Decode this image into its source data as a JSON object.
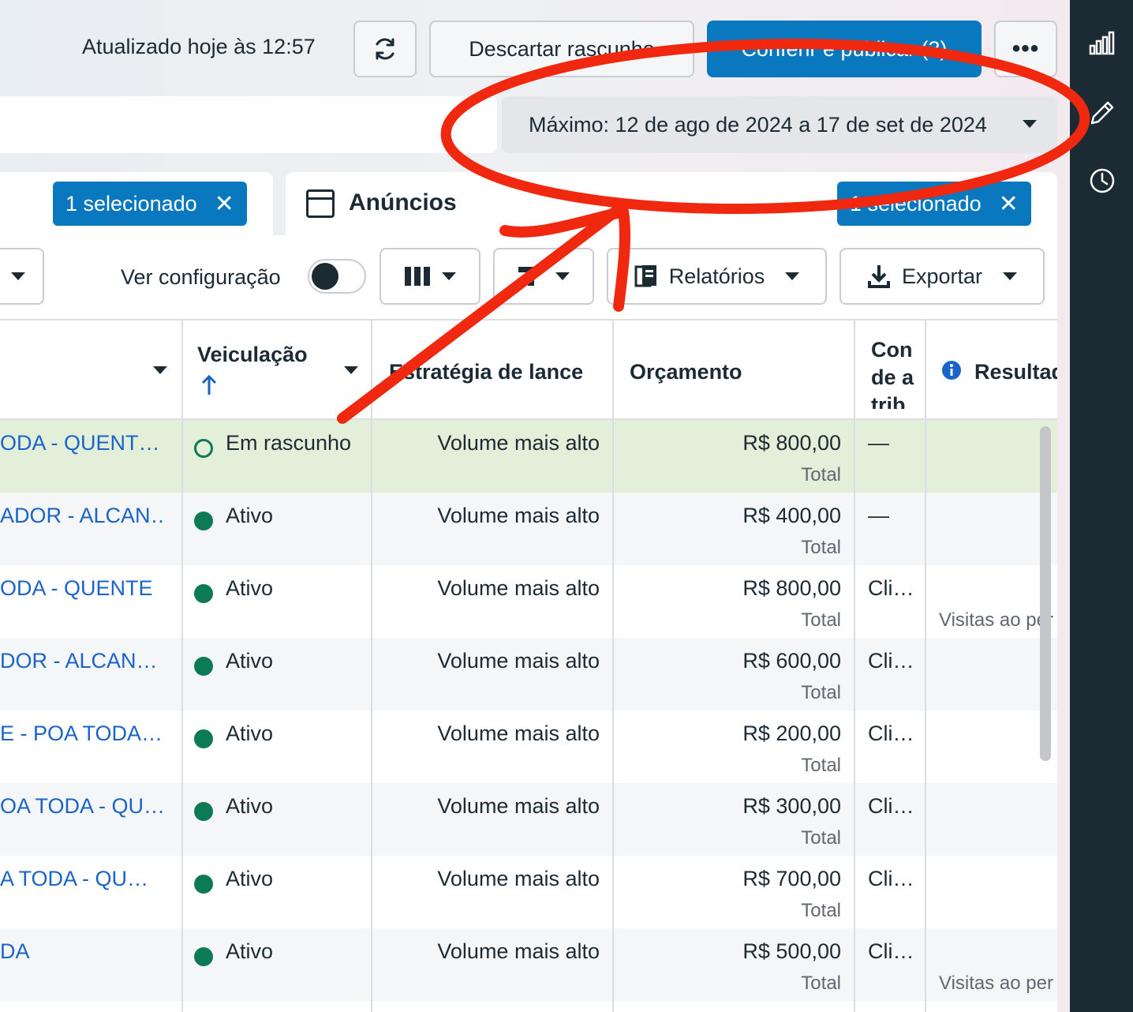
{
  "header": {
    "updated_text": "Atualizado hoje às 12:57",
    "discard_label": "Descartar rascunho",
    "publish_label": "Conferir e publicar (3)",
    "more_label": "•••"
  },
  "date_range": {
    "label": "Máximo: 12 de ago de 2024 a 17 de set de 2024"
  },
  "tabs": {
    "left_chip": "1 selecionado",
    "right_title": "Anúncios",
    "right_chip": "1 selecionado",
    "chip_close": "✕"
  },
  "toolbar": {
    "ver_config_label": "Ver configuração",
    "reports_label": "Relatórios",
    "export_label": "Exportar"
  },
  "table": {
    "headers": {
      "veiculacao": "Veiculação",
      "estrategia": "Estratégia de lance",
      "orcamento": "Orçamento",
      "config": "Configuração de atribuição",
      "config_visible": "Con de atrib",
      "resultados": "Resultados"
    },
    "rows": [
      {
        "name": "ODA - QUENT…",
        "status": "Em rascunho",
        "bid": "Volume mais alto",
        "budget": "R$ 800,00",
        "budget_sub": "Total",
        "attr": "—",
        "result": ""
      },
      {
        "name": "ADOR - ALCAN…",
        "status": "Ativo",
        "bid": "Volume mais alto",
        "budget": "R$ 400,00",
        "budget_sub": "Total",
        "attr": "—",
        "result": ""
      },
      {
        "name": "ODA - QUENTE",
        "status": "Ativo",
        "bid": "Volume mais alto",
        "budget": "R$ 800,00",
        "budget_sub": "Total",
        "attr": "Cli…",
        "result": "Visitas ao per"
      },
      {
        "name": "DOR - ALCAN…",
        "status": "Ativo",
        "bid": "Volume mais alto",
        "budget": "R$ 600,00",
        "budget_sub": "Total",
        "attr": "Cli…",
        "result": ""
      },
      {
        "name": "E - POA TODA…",
        "status": "Ativo",
        "bid": "Volume mais alto",
        "budget": "R$ 200,00",
        "budget_sub": "Total",
        "attr": "Cli…",
        "result": ""
      },
      {
        "name": "OA TODA - QU…",
        "status": "Ativo",
        "bid": "Volume mais alto",
        "budget": "R$ 300,00",
        "budget_sub": "Total",
        "attr": "Cli…",
        "result": ""
      },
      {
        "name": "A TODA - QU…",
        "status": "Ativo",
        "bid": "Volume mais alto",
        "budget": "R$ 700,00",
        "budget_sub": "Total",
        "attr": "Cli…",
        "result": ""
      },
      {
        "name": "DA",
        "status": "Ativo",
        "bid": "Volume mais alto",
        "budget": "R$ 500,00",
        "budget_sub": "Total",
        "attr": "Cli…",
        "result": "Visitas ao per"
      }
    ]
  },
  "colors": {
    "primary": "#0a78be",
    "link": "#1a64c8",
    "status_active": "#0b7a55",
    "selected_row": "#e3efd8",
    "rail": "#1c2b33",
    "annotation": "#f0280f"
  },
  "rail_icons": [
    "bar-chart-icon",
    "pencil-icon",
    "clock-icon"
  ]
}
